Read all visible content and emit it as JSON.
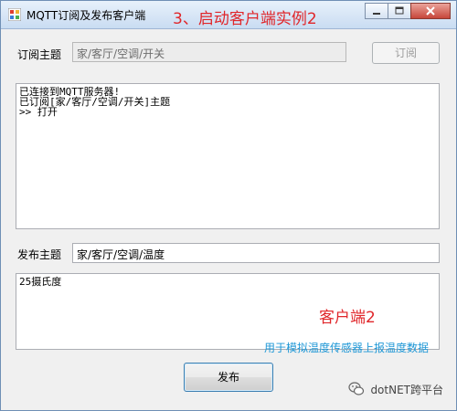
{
  "window": {
    "title": "MQTT订阅及发布客户端",
    "annotation": "3、启动客户端实例2"
  },
  "subscribe": {
    "label": "订阅主题",
    "topic_value": "家/客厅/空调/开关",
    "button_label": "订阅"
  },
  "log": {
    "lines": [
      "已连接到MQTT服务器!",
      "已订阅[家/客厅/空调/开关]主题",
      ">> 打开"
    ]
  },
  "publish": {
    "label": "发布主题",
    "topic_value": "家/客厅/空调/温度",
    "message_value": "25摄氏度",
    "button_label": "发布"
  },
  "annotations": {
    "client_label": "客户端2",
    "description": "用于模拟温度传感器上报温度数据"
  },
  "watermark": {
    "text": "dotNET跨平台"
  },
  "colors": {
    "annotation_red": "#e0262a",
    "annotation_blue": "#1e97d6",
    "window_bg": "#f0f0f0"
  },
  "icons": {
    "app": "app-icon",
    "minimize": "minimize-icon",
    "maximize": "maximize-icon",
    "close": "close-icon",
    "watermark": "wechat-icon"
  }
}
